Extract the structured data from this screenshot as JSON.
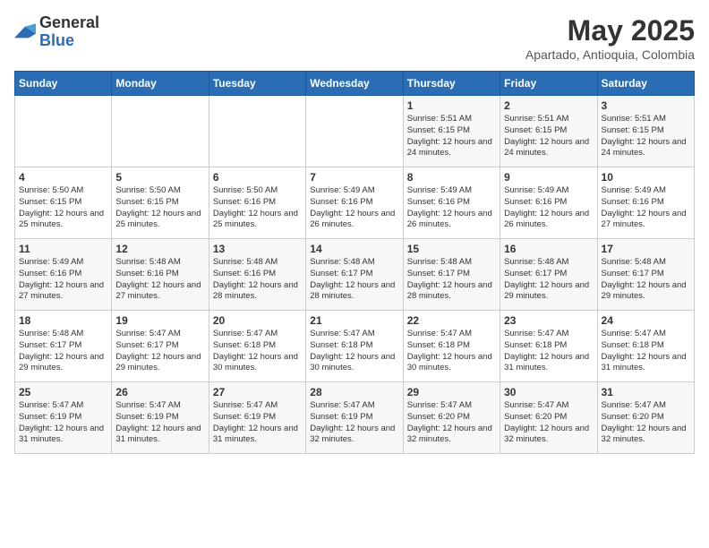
{
  "logo": {
    "general": "General",
    "blue": "Blue"
  },
  "title": "May 2025",
  "subtitle": "Apartado, Antioquia, Colombia",
  "days_header": [
    "Sunday",
    "Monday",
    "Tuesday",
    "Wednesday",
    "Thursday",
    "Friday",
    "Saturday"
  ],
  "weeks": [
    [
      {
        "num": "",
        "info": ""
      },
      {
        "num": "",
        "info": ""
      },
      {
        "num": "",
        "info": ""
      },
      {
        "num": "",
        "info": ""
      },
      {
        "num": "1",
        "info": "Sunrise: 5:51 AM\nSunset: 6:15 PM\nDaylight: 12 hours and 24 minutes."
      },
      {
        "num": "2",
        "info": "Sunrise: 5:51 AM\nSunset: 6:15 PM\nDaylight: 12 hours and 24 minutes."
      },
      {
        "num": "3",
        "info": "Sunrise: 5:51 AM\nSunset: 6:15 PM\nDaylight: 12 hours and 24 minutes."
      }
    ],
    [
      {
        "num": "4",
        "info": "Sunrise: 5:50 AM\nSunset: 6:15 PM\nDaylight: 12 hours and 25 minutes."
      },
      {
        "num": "5",
        "info": "Sunrise: 5:50 AM\nSunset: 6:15 PM\nDaylight: 12 hours and 25 minutes."
      },
      {
        "num": "6",
        "info": "Sunrise: 5:50 AM\nSunset: 6:16 PM\nDaylight: 12 hours and 25 minutes."
      },
      {
        "num": "7",
        "info": "Sunrise: 5:49 AM\nSunset: 6:16 PM\nDaylight: 12 hours and 26 minutes."
      },
      {
        "num": "8",
        "info": "Sunrise: 5:49 AM\nSunset: 6:16 PM\nDaylight: 12 hours and 26 minutes."
      },
      {
        "num": "9",
        "info": "Sunrise: 5:49 AM\nSunset: 6:16 PM\nDaylight: 12 hours and 26 minutes."
      },
      {
        "num": "10",
        "info": "Sunrise: 5:49 AM\nSunset: 6:16 PM\nDaylight: 12 hours and 27 minutes."
      }
    ],
    [
      {
        "num": "11",
        "info": "Sunrise: 5:49 AM\nSunset: 6:16 PM\nDaylight: 12 hours and 27 minutes."
      },
      {
        "num": "12",
        "info": "Sunrise: 5:48 AM\nSunset: 6:16 PM\nDaylight: 12 hours and 27 minutes."
      },
      {
        "num": "13",
        "info": "Sunrise: 5:48 AM\nSunset: 6:16 PM\nDaylight: 12 hours and 28 minutes."
      },
      {
        "num": "14",
        "info": "Sunrise: 5:48 AM\nSunset: 6:17 PM\nDaylight: 12 hours and 28 minutes."
      },
      {
        "num": "15",
        "info": "Sunrise: 5:48 AM\nSunset: 6:17 PM\nDaylight: 12 hours and 28 minutes."
      },
      {
        "num": "16",
        "info": "Sunrise: 5:48 AM\nSunset: 6:17 PM\nDaylight: 12 hours and 29 minutes."
      },
      {
        "num": "17",
        "info": "Sunrise: 5:48 AM\nSunset: 6:17 PM\nDaylight: 12 hours and 29 minutes."
      }
    ],
    [
      {
        "num": "18",
        "info": "Sunrise: 5:48 AM\nSunset: 6:17 PM\nDaylight: 12 hours and 29 minutes."
      },
      {
        "num": "19",
        "info": "Sunrise: 5:47 AM\nSunset: 6:17 PM\nDaylight: 12 hours and 29 minutes."
      },
      {
        "num": "20",
        "info": "Sunrise: 5:47 AM\nSunset: 6:18 PM\nDaylight: 12 hours and 30 minutes."
      },
      {
        "num": "21",
        "info": "Sunrise: 5:47 AM\nSunset: 6:18 PM\nDaylight: 12 hours and 30 minutes."
      },
      {
        "num": "22",
        "info": "Sunrise: 5:47 AM\nSunset: 6:18 PM\nDaylight: 12 hours and 30 minutes."
      },
      {
        "num": "23",
        "info": "Sunrise: 5:47 AM\nSunset: 6:18 PM\nDaylight: 12 hours and 31 minutes."
      },
      {
        "num": "24",
        "info": "Sunrise: 5:47 AM\nSunset: 6:18 PM\nDaylight: 12 hours and 31 minutes."
      }
    ],
    [
      {
        "num": "25",
        "info": "Sunrise: 5:47 AM\nSunset: 6:19 PM\nDaylight: 12 hours and 31 minutes."
      },
      {
        "num": "26",
        "info": "Sunrise: 5:47 AM\nSunset: 6:19 PM\nDaylight: 12 hours and 31 minutes."
      },
      {
        "num": "27",
        "info": "Sunrise: 5:47 AM\nSunset: 6:19 PM\nDaylight: 12 hours and 31 minutes."
      },
      {
        "num": "28",
        "info": "Sunrise: 5:47 AM\nSunset: 6:19 PM\nDaylight: 12 hours and 32 minutes."
      },
      {
        "num": "29",
        "info": "Sunrise: 5:47 AM\nSunset: 6:20 PM\nDaylight: 12 hours and 32 minutes."
      },
      {
        "num": "30",
        "info": "Sunrise: 5:47 AM\nSunset: 6:20 PM\nDaylight: 12 hours and 32 minutes."
      },
      {
        "num": "31",
        "info": "Sunrise: 5:47 AM\nSunset: 6:20 PM\nDaylight: 12 hours and 32 minutes."
      }
    ]
  ]
}
